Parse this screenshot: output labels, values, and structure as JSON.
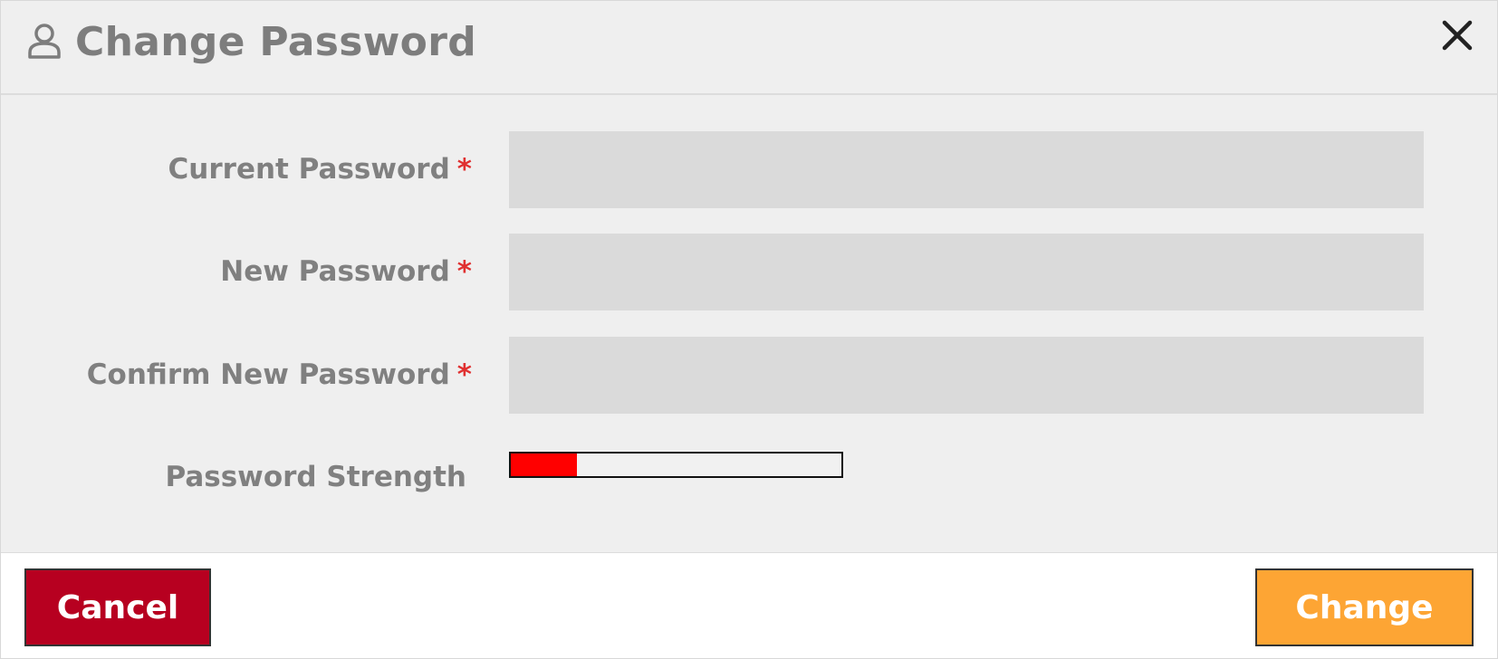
{
  "dialog": {
    "title": "Change Password",
    "icons": {
      "header": "user-icon",
      "close": "close-icon"
    }
  },
  "form": {
    "required_marker": "*",
    "fields": [
      {
        "label": "Current Password",
        "value": "",
        "placeholder": ""
      },
      {
        "label": "New Password",
        "value": "",
        "placeholder": ""
      },
      {
        "label": "Confirm New Password",
        "value": "",
        "placeholder": ""
      }
    ],
    "strength": {
      "label": "Password Strength",
      "level": 0.2,
      "color": "#ff0000"
    }
  },
  "footer": {
    "cancel_label": "Cancel",
    "change_label": "Change",
    "cancel_color": "#b70020",
    "change_color": "#fda534"
  }
}
